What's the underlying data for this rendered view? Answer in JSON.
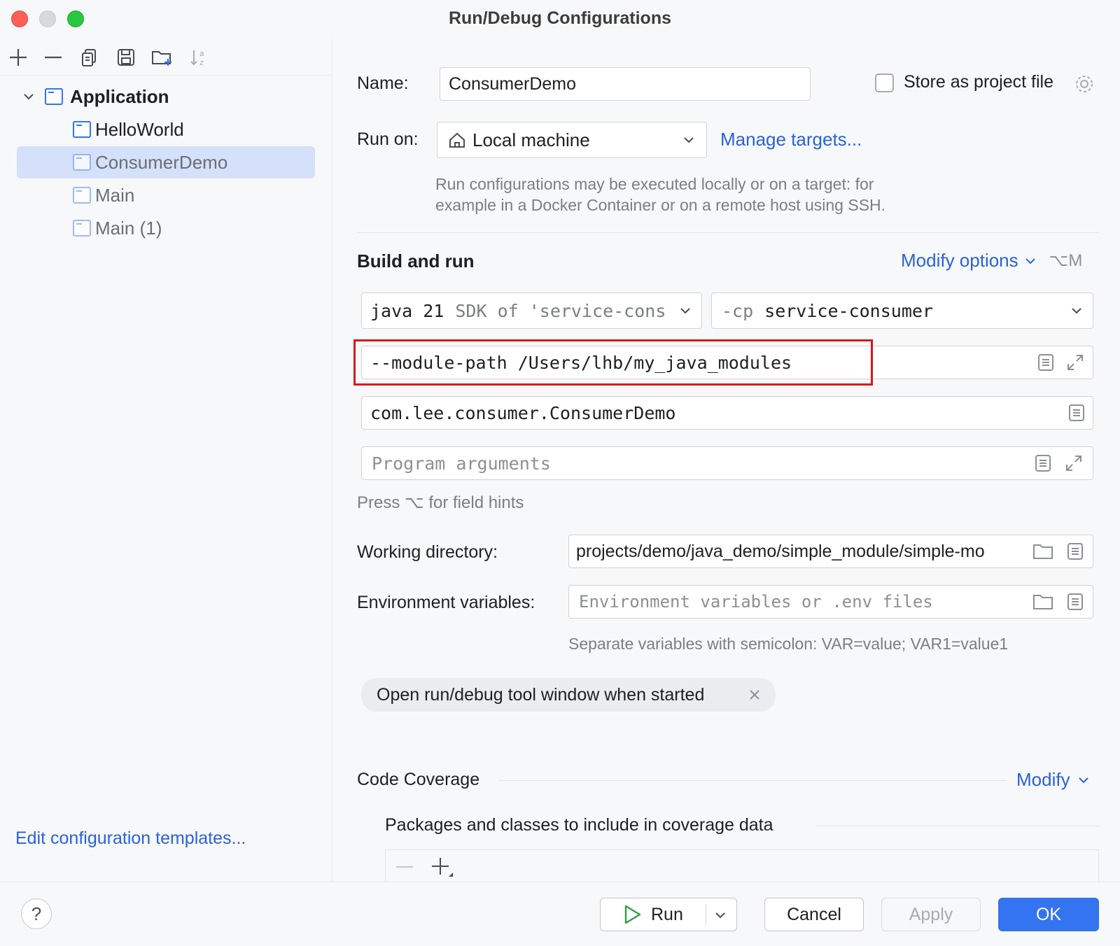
{
  "window": {
    "title": "Run/Debug Configurations"
  },
  "sidebar": {
    "group_label": "Application",
    "items": [
      {
        "label": "HelloWorld"
      },
      {
        "label": "ConsumerDemo"
      },
      {
        "label": "Main"
      },
      {
        "label": "Main (1)"
      }
    ],
    "edit_templates_label": "Edit configuration templates..."
  },
  "form": {
    "name_label": "Name:",
    "name_value": "ConsumerDemo",
    "store_label": "Store as project file",
    "run_on_label": "Run on:",
    "run_on_value": "Local machine",
    "manage_targets": "Manage targets...",
    "run_on_hint_line1": "Run configurations may be executed locally or on a target: for",
    "run_on_hint_line2": "example in a Docker Container or on a remote host using SSH.",
    "build_run_title": "Build and run",
    "modify_options": "Modify options",
    "modify_shortcut": "⌥M",
    "jdk_main": "java 21",
    "jdk_sub": "SDK of 'service-cons",
    "cp_prefix": "-cp",
    "cp_value": "service-consumer",
    "vm_options": "--module-path /Users/lhb/my_java_modules",
    "main_class": "com.lee.consumer.ConsumerDemo",
    "program_args_placeholder": "Program arguments",
    "field_hints": "Press ⌥ for field hints",
    "working_dir_label": "Working directory:",
    "working_dir_value": "projects/demo/java_demo/simple_module/simple-mo",
    "env_label": "Environment variables:",
    "env_placeholder": "Environment variables or .env files",
    "env_hint": "Separate variables with semicolon: VAR=value; VAR1=value1",
    "chip_label": "Open run/debug tool window when started",
    "coverage_title": "Code Coverage",
    "coverage_modify": "Modify",
    "coverage_packages": "Packages and classes to include in coverage data"
  },
  "buttons": {
    "help": "?",
    "run": "Run",
    "cancel": "Cancel",
    "apply": "Apply",
    "ok": "OK"
  },
  "colors": {
    "accent": "#3574f0",
    "link": "#2a62d9",
    "highlight_box": "#e0141e",
    "selection": "#d5e1fa"
  }
}
